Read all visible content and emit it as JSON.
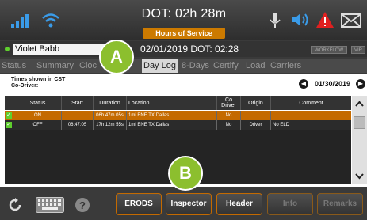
{
  "header": {
    "dot_timer": "DOT: 02h 28m",
    "hos_label": "Hours of Service",
    "icons": [
      "signal-bars-icon",
      "wifi-icon",
      "microphone-icon",
      "speaker-icon",
      "warning-icon",
      "mail-icon"
    ]
  },
  "driver": {
    "name": "Violet Babb",
    "datetime": "02/01/2019  DOT: 02:28",
    "workflow_label": "WORKFLOW",
    "vir_label": "VIR"
  },
  "tabs": [
    {
      "label": "Status"
    },
    {
      "label": "Summary"
    },
    {
      "label": "Cloc"
    },
    {
      "label": "Day Log",
      "active": true
    },
    {
      "label": "8-Days"
    },
    {
      "label": "Certify"
    },
    {
      "label": "Load"
    },
    {
      "label": "Carriers"
    }
  ],
  "log": {
    "info_line1": "Times shown in CST",
    "info_line2": "Co-Driver:",
    "date": "01/30/2019",
    "columns": [
      "Status",
      "Start",
      "Duration",
      "Location",
      "Co Driver",
      "Origin",
      "Comment"
    ],
    "rows": [
      {
        "status": "ON",
        "start": "",
        "duration": "06h 47m 05s",
        "location": "1mi ENE TX Dallas",
        "co_driver": "No",
        "origin": "",
        "comment": ""
      },
      {
        "status": "OFF",
        "start": "06:47:05",
        "duration": "17h 12m 55s",
        "location": "1mi ENE TX Dallas",
        "co_driver": "No",
        "origin": "Driver",
        "comment": "No ELD"
      }
    ]
  },
  "bottom": {
    "erods": "ERODS",
    "inspector": "Inspector",
    "header": "Header",
    "info": "Info",
    "remarks": "Remarks"
  },
  "callouts": {
    "a": "A",
    "b": "B"
  },
  "colors": {
    "accent": "#c46a00",
    "callout": "#8cbf2e",
    "status_green": "#5fcf2e"
  }
}
